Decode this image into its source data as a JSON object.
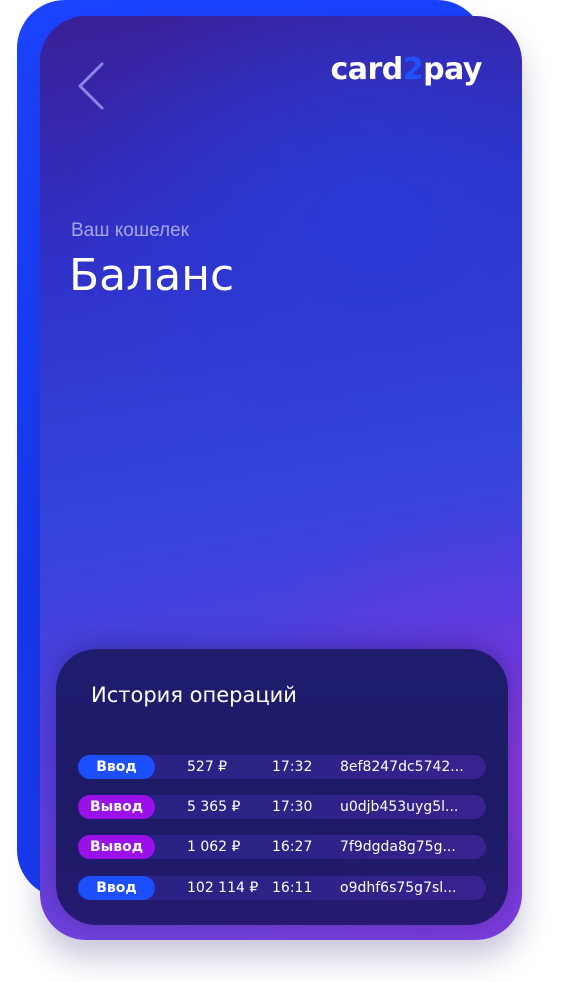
{
  "header": {
    "back_icon": "chevron-left-icon",
    "logo": {
      "part1": "card",
      "part2": "2",
      "part3": "pay"
    }
  },
  "colors": {
    "accent": "#1d52ff",
    "deposit_badge": "#1c4fff",
    "withdraw_badge": "#9a10e8"
  },
  "main": {
    "subtitle": "Ваш кошелек",
    "title": "Баланс"
  },
  "history": {
    "title": "История операций",
    "rows": [
      {
        "type": "Ввод",
        "amount": "527 ₽",
        "time": "17:32",
        "hash": "8ef8247dc5742..."
      },
      {
        "type": "Вывод",
        "amount": "5 365 ₽",
        "time": "17:30",
        "hash": "u0djb453uyg5l..."
      },
      {
        "type": "Вывод",
        "amount": "1 062 ₽",
        "time": "16:27",
        "hash": "7f9dgda8g75g..."
      },
      {
        "type": "Ввод",
        "amount": "102 114 ₽",
        "time": "16:11",
        "hash": "o9dhf6s75g7sl..."
      }
    ]
  }
}
